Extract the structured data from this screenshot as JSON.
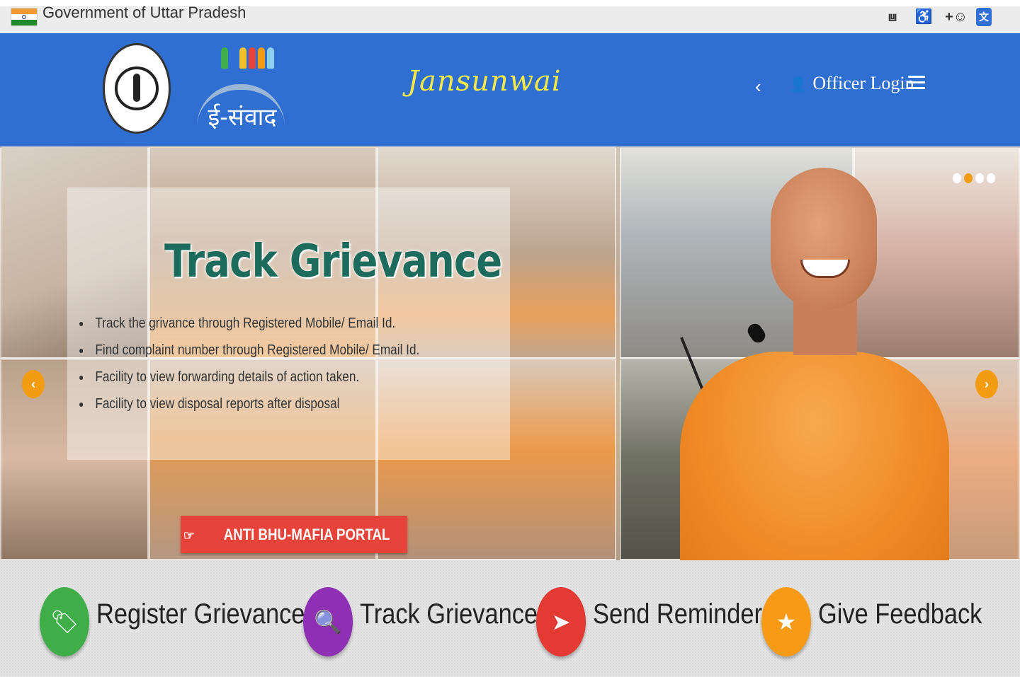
{
  "topbar": {
    "title": "Government of Uttar Pradesh",
    "icons": [
      "audio-icon",
      "accessibility-icon",
      "add-users-icon",
      "translate-icon"
    ]
  },
  "header": {
    "emblem_name": "uttar-pradesh-emblem",
    "esamvad_text": "ई-संवाद",
    "brand": "Jansunwai",
    "officer_login": "Officer Login"
  },
  "hero": {
    "title": "Track Grievance",
    "bullets": [
      "Track the grivance through Registered Mobile/ Email Id.",
      "Find complaint number through Registered Mobile/ Email Id.",
      "Facility to view forwarding details of action taken.",
      "Facility to view disposal reports after disposal"
    ],
    "anti_button": "ANTI BHU-MAFIA PORTAL",
    "prev_arrow": "‹",
    "next_arrow": "›",
    "slide_count": 4,
    "active_slide": 2
  },
  "actions": [
    {
      "label": "Register Grievance",
      "icon": "tag-icon",
      "color": "#3fae49"
    },
    {
      "label": "Track Grievance",
      "icon": "search-icon",
      "color": "#8e2fb4"
    },
    {
      "label": "Send Reminder",
      "icon": "paper-plane-icon",
      "color": "#e33a33"
    },
    {
      "label": "Give Feedback",
      "icon": "star-icon",
      "color": "#f79a16"
    }
  ],
  "colors": {
    "header_blue": "#2f6fd1",
    "accent_orange": "#f39c12",
    "anti_red": "#e8433a"
  }
}
